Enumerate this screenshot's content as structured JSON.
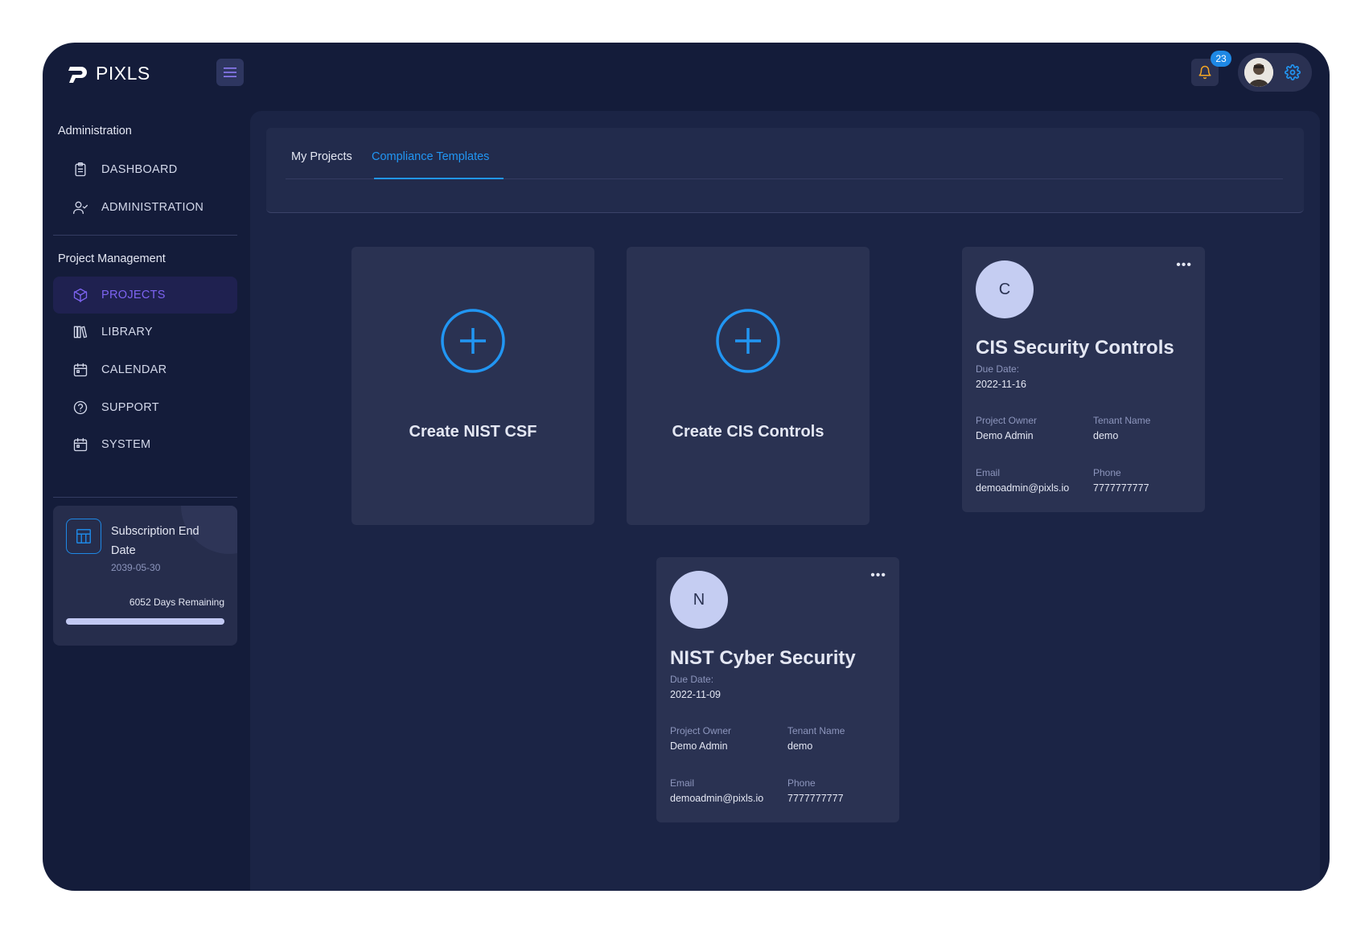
{
  "app": {
    "name": "PIXLS"
  },
  "header": {
    "notification_count": "23"
  },
  "sidebar": {
    "sections": [
      {
        "title": "Administration"
      },
      {
        "title": "Project Management"
      }
    ],
    "items": [
      {
        "label": "DASHBOARD",
        "icon": "clipboard-icon"
      },
      {
        "label": "ADMINISTRATION",
        "icon": "user-check-icon"
      },
      {
        "label": "PROJECTS",
        "icon": "cube-icon",
        "active": true
      },
      {
        "label": "LIBRARY",
        "icon": "books-icon"
      },
      {
        "label": "CALENDAR",
        "icon": "calendar-icon"
      },
      {
        "label": "SUPPORT",
        "icon": "help-circle-icon"
      },
      {
        "label": "SYSTEM",
        "icon": "calendar-icon"
      }
    ],
    "subscription": {
      "title": "Subscription End Date",
      "date": "2039-05-30",
      "days_remaining": "6052 Days Remaining",
      "progress_percent": 100
    }
  },
  "tabs": [
    {
      "label": "My Projects",
      "active": false
    },
    {
      "label": "Compliance Templates",
      "active": true
    }
  ],
  "create_cards": [
    {
      "label": "Create NIST CSF"
    },
    {
      "label": "Create CIS Controls"
    }
  ],
  "projects": [
    {
      "initial": "C",
      "name": "CIS Security Controls",
      "due_label": "Due Date:",
      "due_date": "2022-11-16",
      "owner_label": "Project Owner",
      "owner": "Demo Admin",
      "tenant_label": "Tenant Name",
      "tenant": "demo",
      "email_label": "Email",
      "email": "demoadmin@pixls.io",
      "phone_label": "Phone",
      "phone": "7777777777"
    },
    {
      "initial": "N",
      "name": "NIST Cyber Security",
      "due_label": "Due Date:",
      "due_date": "2022-11-09",
      "owner_label": "Project Owner",
      "owner": "Demo Admin",
      "tenant_label": "Tenant Name",
      "tenant": "demo",
      "email_label": "Email",
      "email": "demoadmin@pixls.io",
      "phone_label": "Phone",
      "phone": "7777777777"
    }
  ],
  "colors": {
    "accent": "#2196f3",
    "active_nav": "#7e64f2",
    "background": "#141c3a",
    "bell": "#f5a623"
  }
}
